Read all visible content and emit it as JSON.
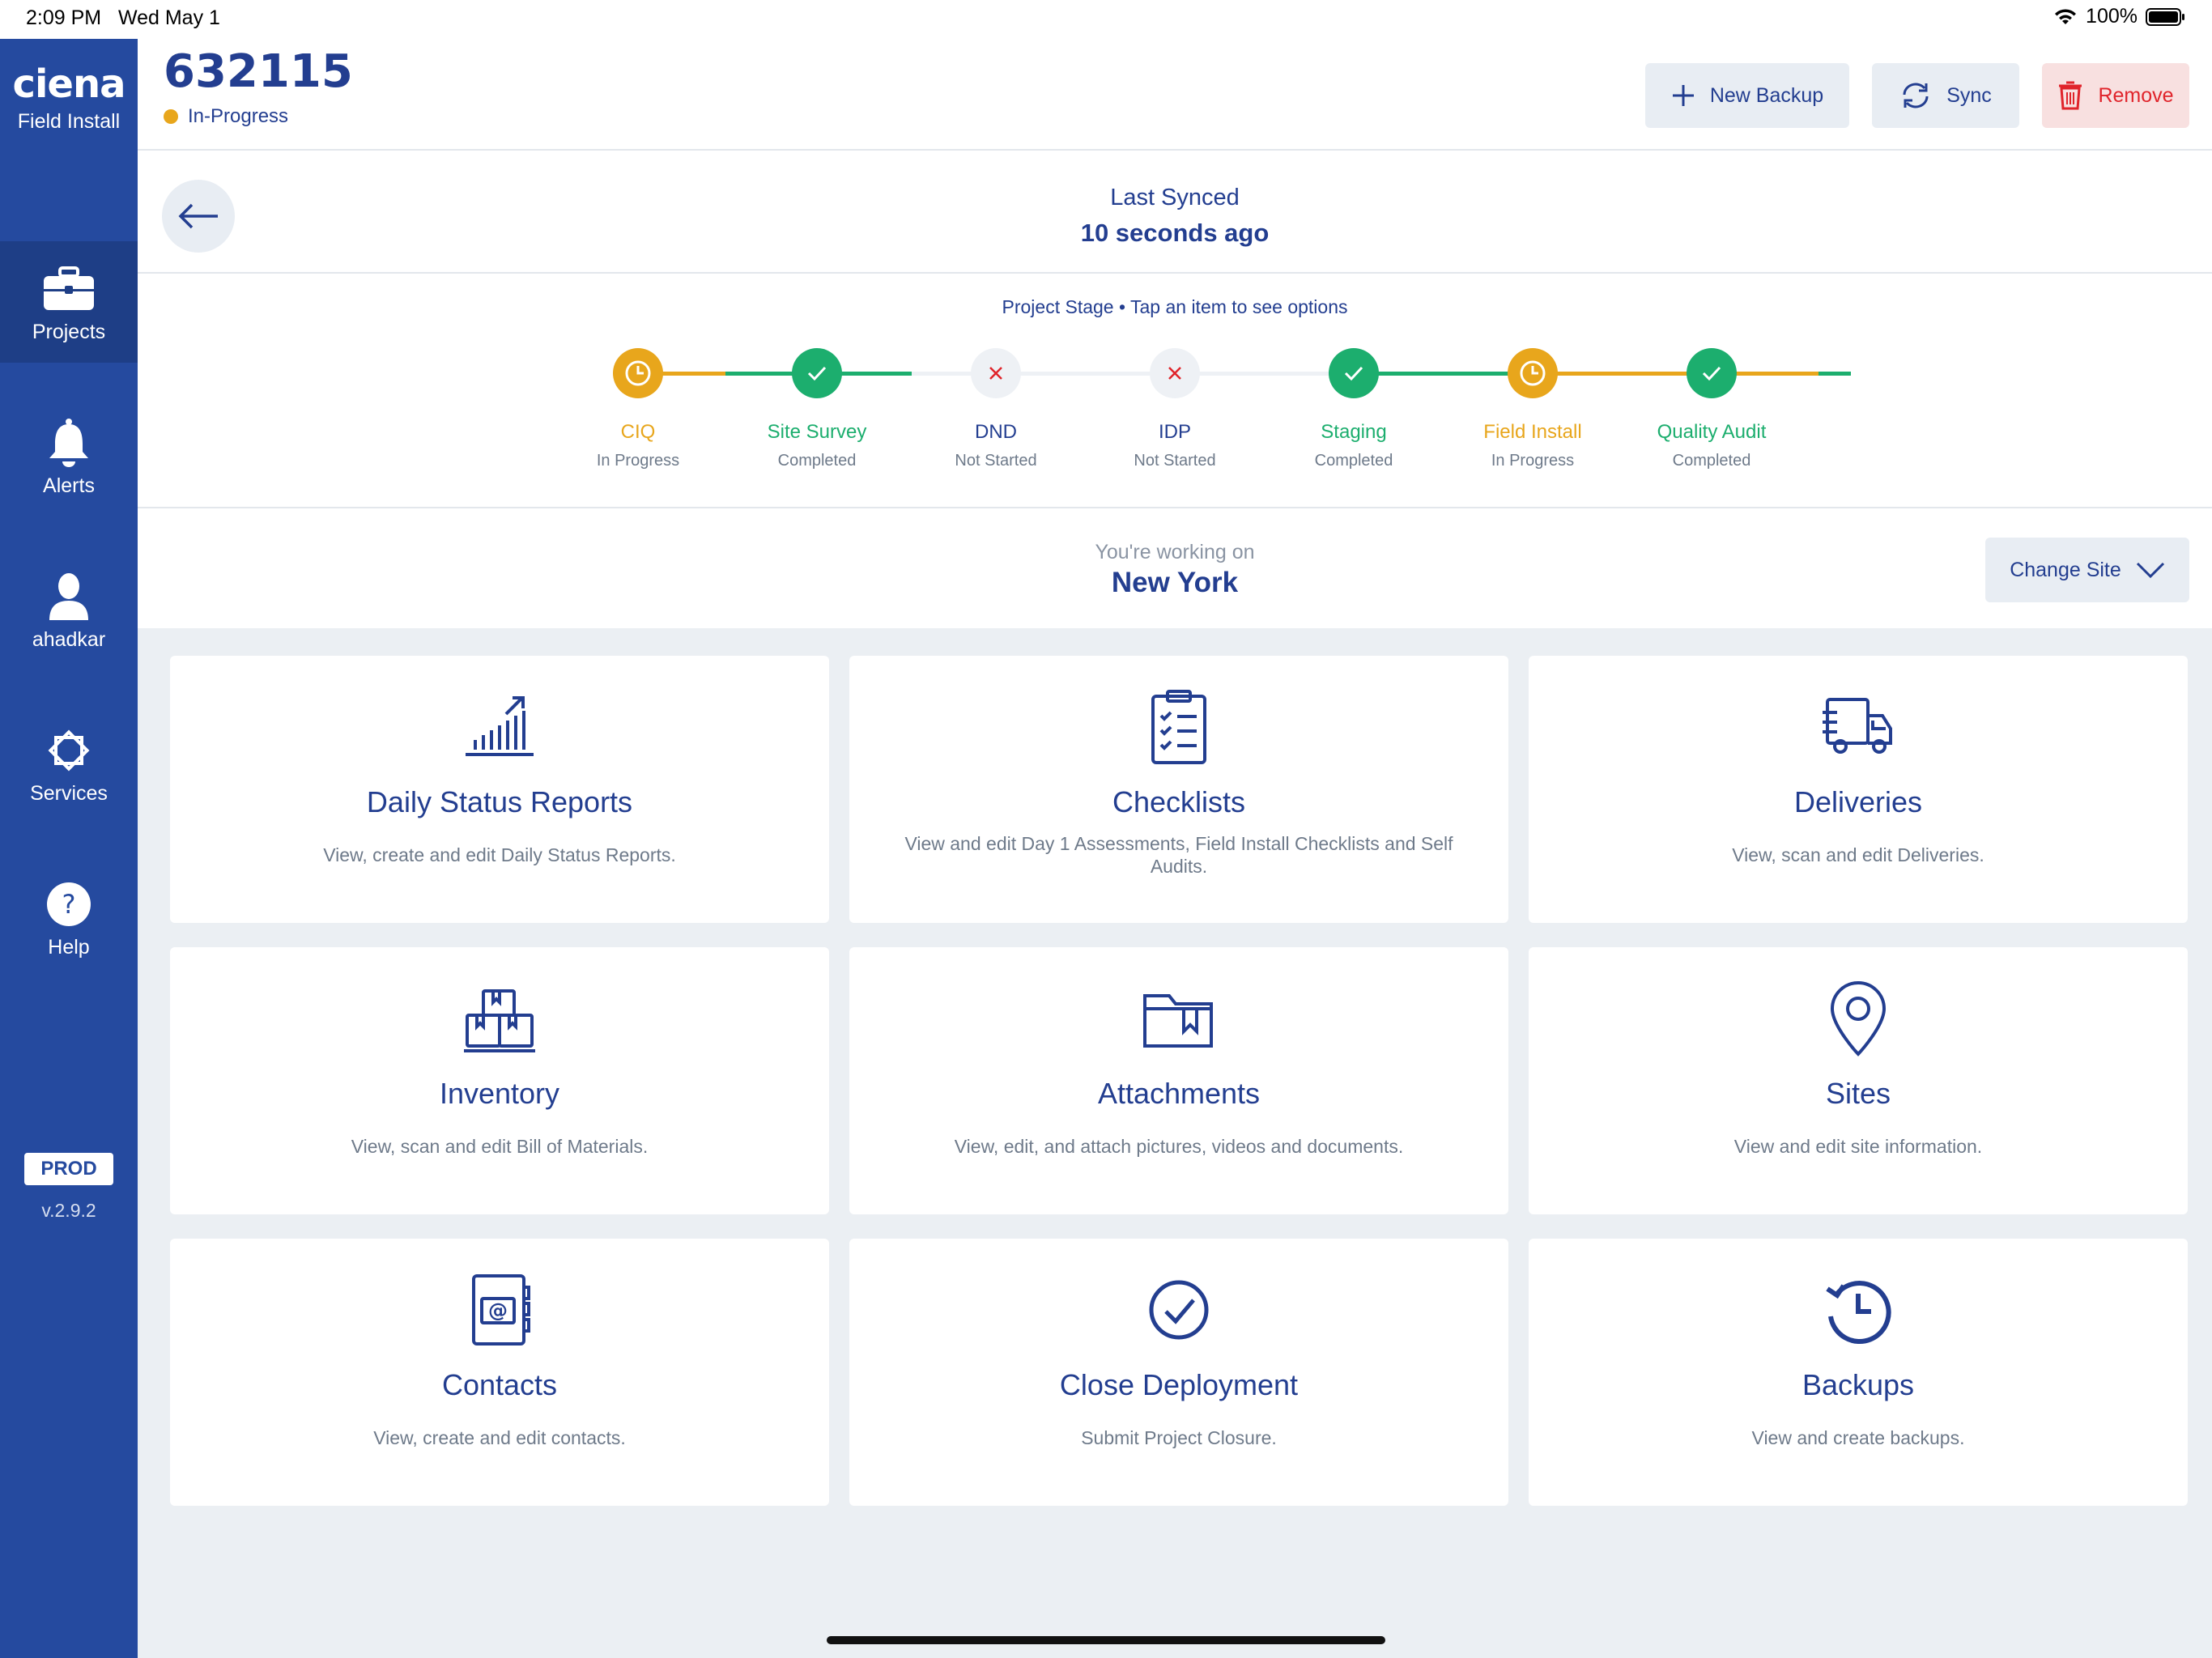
{
  "status_bar": {
    "time": "2:09 PM",
    "date": "Wed May 1",
    "battery": "100%"
  },
  "sidebar": {
    "logo": "ciena",
    "app_name": "Field Install",
    "items": [
      {
        "label": "Projects",
        "icon": "briefcase-icon",
        "active": true
      },
      {
        "label": "Alerts",
        "icon": "bell-icon",
        "active": false
      },
      {
        "label": "ahadkar",
        "icon": "user-icon",
        "active": false
      },
      {
        "label": "Services",
        "icon": "services-icon",
        "active": false
      },
      {
        "label": "Help",
        "icon": "help-icon",
        "active": false
      }
    ],
    "env_badge": "PROD",
    "version": "v.2.9.2"
  },
  "header": {
    "project_id": "632115",
    "status": "In-Progress",
    "new_backup_label": "New Backup",
    "sync_label": "Sync",
    "remove_label": "Remove"
  },
  "sync": {
    "label": "Last Synced",
    "value": "10 seconds ago"
  },
  "stages": {
    "hint": "Project Stage • Tap an item to see options",
    "items": [
      {
        "name": "CIQ",
        "status": "In Progress",
        "state": "progress"
      },
      {
        "name": "Site Survey",
        "status": "Completed",
        "state": "done"
      },
      {
        "name": "DND",
        "status": "Not Started",
        "state": "none"
      },
      {
        "name": "IDP",
        "status": "Not Started",
        "state": "none"
      },
      {
        "name": "Staging",
        "status": "Completed",
        "state": "done"
      },
      {
        "name": "Field Install",
        "status": "In Progress",
        "state": "progress"
      },
      {
        "name": "Quality Audit",
        "status": "Completed",
        "state": "done"
      }
    ]
  },
  "site": {
    "label": "You're working on",
    "name": "New York",
    "change_label": "Change Site"
  },
  "cards": [
    {
      "title": "Daily Status Reports",
      "desc": "View, create and edit Daily Status Reports.",
      "icon": "chart-icon"
    },
    {
      "title": "Checklists",
      "desc": "View and edit Day 1 Assessments, Field Install Checklists and Self Audits.",
      "icon": "checklist-icon"
    },
    {
      "title": "Deliveries",
      "desc": "View, scan and edit Deliveries.",
      "icon": "truck-icon"
    },
    {
      "title": "Inventory",
      "desc": "View, scan and edit Bill of Materials.",
      "icon": "boxes-icon"
    },
    {
      "title": "Attachments",
      "desc": "View, edit, and attach pictures, videos and documents.",
      "icon": "folder-icon"
    },
    {
      "title": "Sites",
      "desc": "View and edit site information.",
      "icon": "location-pin-icon"
    },
    {
      "title": "Contacts",
      "desc": "View, create and edit contacts.",
      "icon": "address-book-icon"
    },
    {
      "title": "Close Deployment",
      "desc": "Submit Project Closure.",
      "icon": "check-circle-icon"
    },
    {
      "title": "Backups",
      "desc": "View and create backups.",
      "icon": "history-icon"
    }
  ],
  "colors": {
    "brand": "#254a9f",
    "text": "#233e90",
    "progress": "#e8a61c",
    "done": "#1cae6e",
    "none": "#e0242b",
    "remove": "#e0242b"
  }
}
